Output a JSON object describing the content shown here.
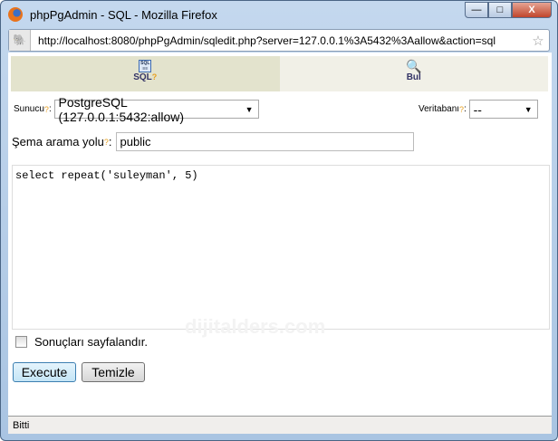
{
  "window": {
    "title": "phpPgAdmin - SQL - Mozilla Firefox",
    "minimize": "▭",
    "maximize": "□",
    "close": "X"
  },
  "address": {
    "url": "http://localhost:8080/phpPgAdmin/sqledit.php?server=127.0.0.1%3A5432%3Aallow&action=sql"
  },
  "tabs": [
    {
      "label": "SQL",
      "help": "?",
      "icon": "sql-icon"
    },
    {
      "label": "Bul",
      "icon": "magnifier-icon"
    }
  ],
  "server": {
    "label": "Sunucu",
    "help": "?",
    "value": "PostgreSQL (127.0.0.1:5432:allow)"
  },
  "database": {
    "label": "Veritabanı",
    "help": "?",
    "value": "--"
  },
  "schema": {
    "label": "Şema arama yolu",
    "help": "?",
    "value": "public"
  },
  "query": "select repeat('suleyman', 5)",
  "watermark": "dijitalders.com",
  "paginate": {
    "label": "Sonuçları sayfalandır.",
    "checked": false
  },
  "buttons": {
    "execute": "Execute",
    "clear": "Temizle"
  },
  "status": "Bitti"
}
